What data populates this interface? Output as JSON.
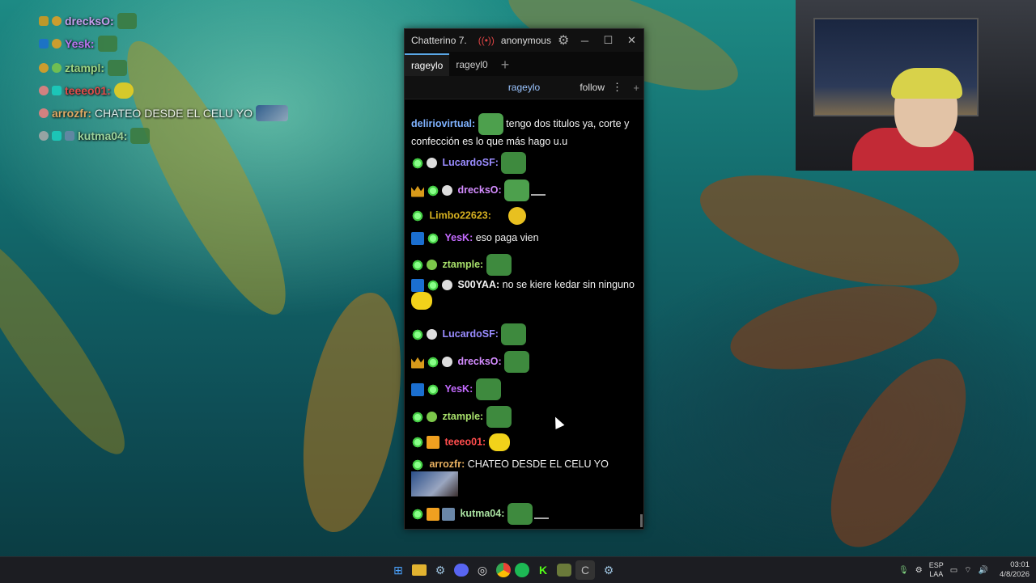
{
  "overlay": {
    "lines": [
      {
        "name": "drecksO:",
        "color": "#e0a0ff"
      },
      {
        "name": "Yesk:",
        "color": "#d070ff"
      },
      {
        "name": "ztampl:",
        "color": "#b0e080"
      },
      {
        "name": "teeeo01:",
        "color": "#ff4040"
      },
      {
        "name": "arrozfr:",
        "text": "CHATEO DESDE EL CELU YO",
        "color": "#ffb060"
      },
      {
        "name": "kutma04:",
        "color": "#b0e0a0"
      }
    ]
  },
  "window": {
    "app_title": "Chatterino 7.",
    "user": "anonymous",
    "tabs": [
      "rageylo",
      "rageyl0"
    ],
    "channel": "rageylo",
    "follow_label": "follow"
  },
  "messages": [
    {
      "name": "deliriovirtual:",
      "color": "#7fb2ff",
      "text": "tengo dos titulos ya, corte y confección es lo que más hago u.u"
    },
    {
      "name": "LucardoSF:",
      "color": "#9a8cff",
      "text": ""
    },
    {
      "name": "drecksO:",
      "color": "#d48cff",
      "text": ""
    },
    {
      "name": "Limbo22623:",
      "color": "#d6b020",
      "text": ""
    },
    {
      "name": "YesK:",
      "color": "#c46bff",
      "text": "eso paga vien"
    },
    {
      "name": "ztample:",
      "color": "#a8e06b",
      "text": ""
    },
    {
      "name": "S00YAA:",
      "color": "#f2f2f2",
      "text": "no se kiere kedar sin ninguno"
    },
    {
      "name": "LucardoSF:",
      "color": "#9a8cff",
      "text": ""
    },
    {
      "name": "drecksO:",
      "color": "#d48cff",
      "text": ""
    },
    {
      "name": "YesK:",
      "color": "#c46bff",
      "text": ""
    },
    {
      "name": "ztample:",
      "color": "#a8e06b",
      "text": ""
    },
    {
      "name": "teeeo01:",
      "color": "#ff4d4d",
      "text": ""
    },
    {
      "name": "arrozfr:",
      "color": "#e8b060",
      "text": "CHATEO DESDE EL CELU YO"
    },
    {
      "name": "kutma04:",
      "color": "#a8e0a0",
      "text": ""
    }
  ],
  "taskbar": {
    "icons": [
      "windows-start-icon",
      "file-explorer-icon",
      "steam-icon",
      "discord-icon",
      "obs-icon",
      "chrome-icon",
      "spotify-icon",
      "kick-icon",
      "game-icon",
      "chatterino-icon",
      "steam-alt-icon"
    ],
    "lang_top": "ESP",
    "lang_bottom": "LAA",
    "time": "03:01",
    "date": "4/8/2026"
  }
}
